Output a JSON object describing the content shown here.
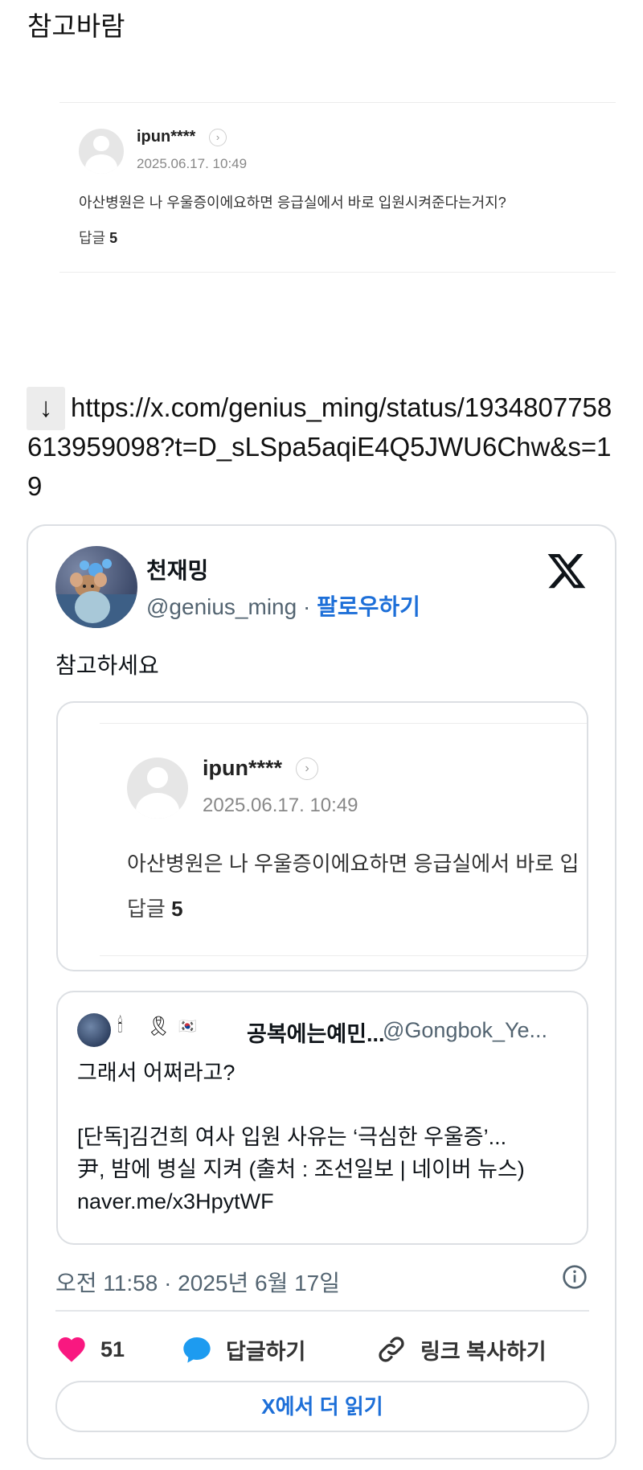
{
  "post": {
    "title": "참고바람",
    "link_arrow": "↓",
    "link_url": "https://x.com/genius_ming/status/1934807758613959098?t=D_sLSpa5aqiE4Q5JWU6Chw&s=19"
  },
  "comment": {
    "username": "ipun****",
    "date": "2025.06.17. 10:49",
    "text": "아산병원은 나 우울증이에요하면 응급실에서 바로 입원시켜준다는거지?",
    "reply_label": "답글",
    "reply_count": "5"
  },
  "tweet": {
    "author_name": "천재밍",
    "author_handle": "@genius_ming",
    "separator": "·",
    "follow_label": "팔로우하기",
    "body": "참고하세요",
    "quoted_image": {
      "username": "ipun****",
      "date": "2025.06.17. 10:49",
      "text": "아산병원은 나 우울증이에요하면 응급실에서 바로 입",
      "reply_label": "답글",
      "reply_count": "5"
    },
    "quoted_tweet": {
      "emoji_1": "🕯",
      "emoji_2": "🎗",
      "emoji_3": "🇰🇷",
      "author_name": "공복에는예민...",
      "author_handle": "@Gongbok_Ye...",
      "line_1": "그래서 어쩌라고?",
      "line_2": "",
      "line_3": "[단독]김건희 여사 입원 사유는 ‘극심한 우울증’...",
      "line_4": "尹, 밤에 병실 지켜 (출처 : 조선일보 | 네이버 뉴스)",
      "line_5": "naver.me/x3HpytWF"
    },
    "timestamp": "오전 11:58 · 2025년 6월 17일",
    "like_count": "51",
    "reply_action": "답글하기",
    "copy_link_action": "링크 복사하기",
    "read_more": "X에서 더 읽기",
    "colors": {
      "like": "#f91880",
      "reply": "#1d9bf0",
      "link_blue": "#1d6fd8"
    },
    "icons": [
      "x-logo-icon",
      "info-icon",
      "heart-icon",
      "speech-bubble-icon",
      "link-icon"
    ]
  }
}
